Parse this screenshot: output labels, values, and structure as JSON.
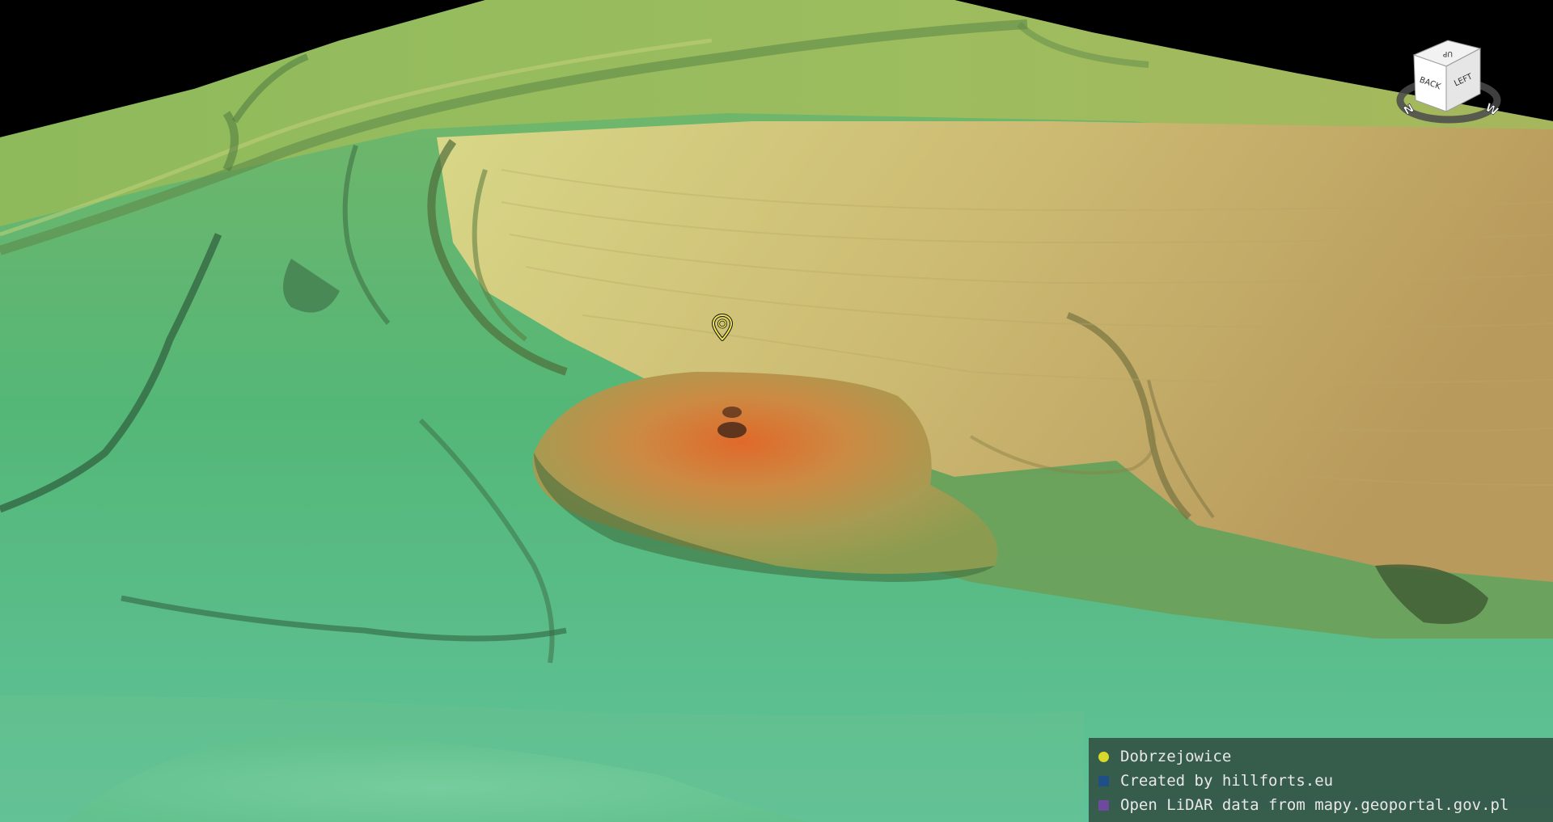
{
  "map": {
    "view": "3D LiDAR terrain relief",
    "colors": {
      "low": "#4fb87a",
      "mid": "#9cc35c",
      "high": "#c9a85a",
      "peak": "#d7692c",
      "sky": "#000000"
    }
  },
  "marker": {
    "icon": "map-pin-icon",
    "color": "#f0e84a"
  },
  "nav_cube": {
    "faces": {
      "top": "UP",
      "front": "BACK",
      "side": "LEFT"
    },
    "compass": {
      "left": "N",
      "right": "W"
    }
  },
  "legend": {
    "items": [
      {
        "label": "Dobrzejowice",
        "color": "#d9d92b",
        "shape": "circle"
      },
      {
        "label": "Created by hillforts.eu",
        "color": "#1e4f86",
        "shape": "square"
      },
      {
        "label": "Open LiDAR data from mapy.geoportal.gov.pl",
        "color": "#6e4a9e",
        "shape": "square"
      }
    ]
  }
}
